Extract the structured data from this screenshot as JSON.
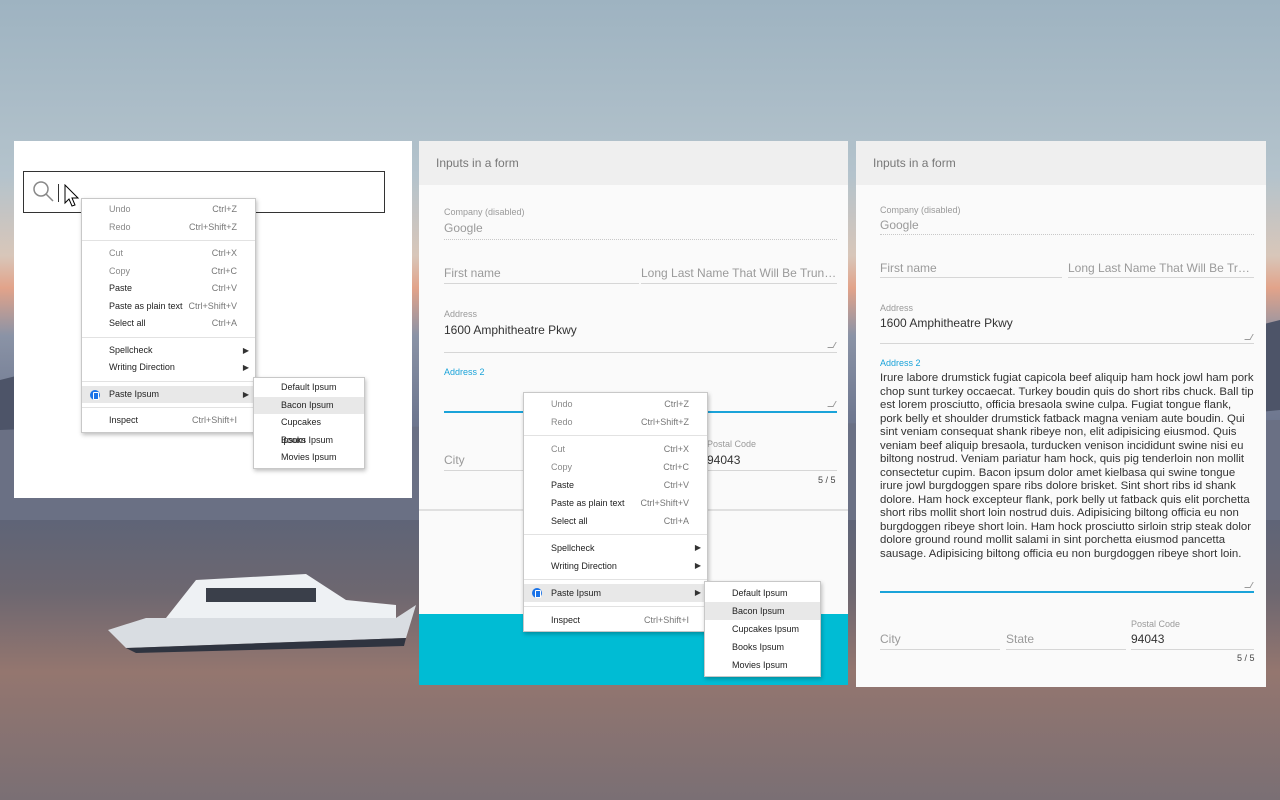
{
  "colors": {
    "accent": "#1aa3d9",
    "teal_band": "#00bcd4",
    "paste_icon": "#1a73e8"
  },
  "context_menu": {
    "undo": "Undo",
    "undo_sc": "Ctrl+Z",
    "redo": "Redo",
    "redo_sc": "Ctrl+Shift+Z",
    "cut": "Cut",
    "cut_sc": "Ctrl+X",
    "copy": "Copy",
    "copy_sc": "Ctrl+C",
    "paste": "Paste",
    "paste_sc": "Ctrl+V",
    "paste_plain": "Paste as plain text",
    "paste_plain_sc": "Ctrl+Shift+V",
    "select_all": "Select all",
    "select_all_sc": "Ctrl+A",
    "spellcheck": "Spellcheck",
    "writing_direction": "Writing Direction",
    "paste_ipsum": "Paste Ipsum",
    "inspect": "Inspect",
    "inspect_sc": "Ctrl+Shift+I"
  },
  "submenu": [
    "Default Ipsum",
    "Bacon Ipsum",
    "Cupcakes Ipsum",
    "Books Ipsum",
    "Movies Ipsum"
  ],
  "form": {
    "header": "Inputs in a form",
    "company_label": "Company (disabled)",
    "company_value": "Google",
    "first_name_ph": "First name",
    "last_name_ph": "Long Last Name That Will Be Truncated And Stuff",
    "address_label": "Address",
    "address_value": "1600 Amphitheatre Pkwy",
    "address2_label": "Address 2",
    "city_ph": "City",
    "state_ph": "State",
    "postal_label": "Postal Code",
    "postal_value": "94043",
    "counter": "5 / 5"
  },
  "address2_text": "Irure labore drumstick fugiat capicola beef aliquip ham hock jowl ham pork chop sunt turkey occaecat. Turkey boudin quis do short ribs chuck. Ball tip est lorem prosciutto, officia bresaola swine culpa. Fugiat tongue flank, pork belly et shoulder drumstick fatback magna veniam aute boudin. Qui sint veniam consequat shank ribeye non, elit adipisicing eiusmod. Quis veniam beef aliquip bresaola, turducken venison incididunt swine nisi eu biltong nostrud. Veniam pariatur ham hock, quis pig tenderloin non mollit consectetur cupim. Bacon ipsum dolor amet kielbasa qui swine tongue irure jowl burgdoggen spare ribs dolore brisket. Sint short ribs id shank dolore. Ham hock excepteur flank, pork belly ut fatback quis elit porchetta short ribs mollit short loin nostrud duis. Adipisicing biltong officia eu non burgdoggen ribeye short loin. Ham hock prosciutto sirloin strip steak dolor dolore ground round mollit salami in sint porchetta eiusmod pancetta sausage. Adipisicing biltong officia eu non burgdoggen ribeye short loin."
}
